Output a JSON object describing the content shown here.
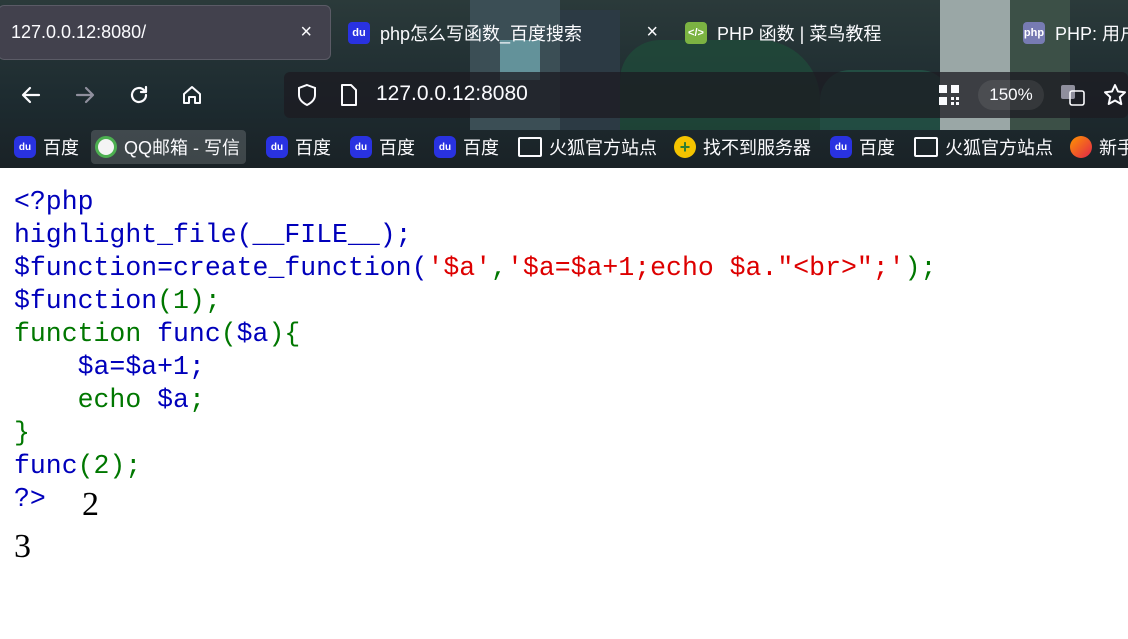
{
  "browser": {
    "tabs": [
      {
        "title": "127.0.0.12:8080/",
        "active": true,
        "close": "×"
      },
      {
        "title": "php怎么写函数_百度搜索",
        "icon": "baidu-paw-icon",
        "close": "×"
      },
      {
        "title": "PHP 函数 | 菜鸟教程",
        "icon": "runoob-icon"
      },
      {
        "title": "PHP: 用户",
        "icon": "php-icon",
        "icon_text": "php"
      }
    ],
    "url": "127.0.0.12:8080",
    "zoom": "150%",
    "bookmarks": [
      {
        "label": "百度",
        "icon": "baidu-paw-icon"
      },
      {
        "label": "QQ邮箱 - 写信",
        "icon": "qq-mail-icon"
      },
      {
        "label": "百度",
        "icon": "baidu-paw-icon"
      },
      {
        "label": "百度",
        "icon": "baidu-paw-icon"
      },
      {
        "label": "百度",
        "icon": "baidu-paw-icon"
      },
      {
        "label": "火狐官方站点",
        "icon": "folder-icon"
      },
      {
        "label": "找不到服务器",
        "icon": "cross-icon"
      },
      {
        "label": "百度",
        "icon": "baidu-paw-icon"
      },
      {
        "label": "火狐官方站点",
        "icon": "folder-icon"
      },
      {
        "label": "新手",
        "icon": "firefox-icon"
      }
    ]
  },
  "source": {
    "line1": "<?php",
    "line2": "highlight_file(__FILE__);",
    "line3": {
      "var": "$function",
      "assign_fn": "=create_function(",
      "arg1": "'$a'",
      "comma": ",",
      "arg2": "'$a=$a+1;echo $a.\"<br>\";'",
      "end": ");"
    },
    "line4_a": "$function",
    "line4_b": "(1);",
    "line5_a": "function ",
    "line5_b": "func",
    "line5_c": "(",
    "line5_d": "$a",
    "line5_e": "){",
    "line6": "    $a=$a+1;",
    "line7_a": "    echo ",
    "line7_b": "$a",
    "line7_c": ";",
    "line8": "}",
    "line9_a": "func",
    "line9_b": "(2);",
    "line10": "?>"
  },
  "output": {
    "first": "2",
    "second": "3"
  },
  "colors": {
    "html": "#0000bb",
    "keyword": "#007700",
    "string": "#dd0000"
  }
}
